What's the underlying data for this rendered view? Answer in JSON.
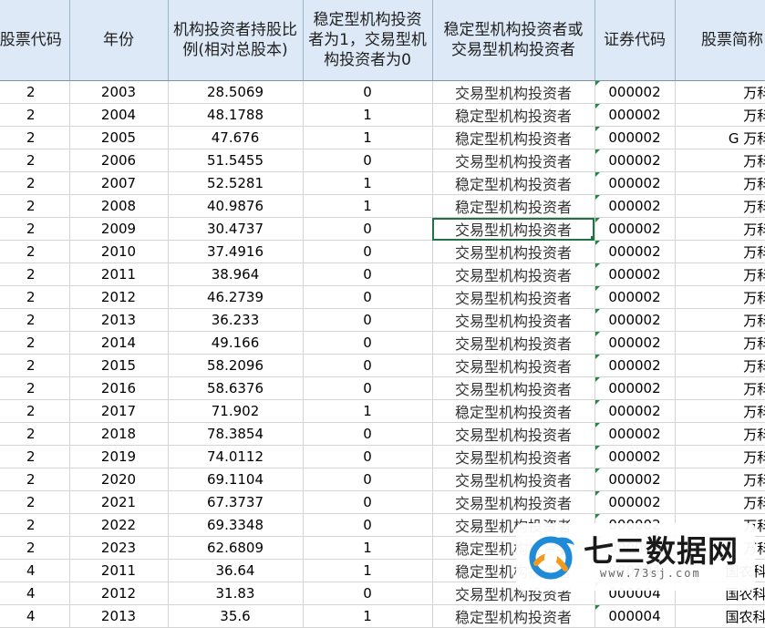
{
  "headers": [
    "股票代码",
    "年份",
    "机构投资者持股比例(相对总股本)",
    "稳定型机构投资者为1，交易型机构投资者为0",
    "稳定型机构投资者或交易型机构投资者",
    "证券代码",
    "股票简称"
  ],
  "rows": [
    [
      "2",
      "2003",
      "28.5069",
      "0",
      "交易型机构投资者",
      "000002",
      "万科A"
    ],
    [
      "2",
      "2004",
      "48.1788",
      "1",
      "稳定型机构投资者",
      "000002",
      "万科A"
    ],
    [
      "2",
      "2005",
      "47.676",
      "1",
      "稳定型机构投资者",
      "000002",
      "G 万科A"
    ],
    [
      "2",
      "2006",
      "51.5455",
      "0",
      "交易型机构投资者",
      "000002",
      "万科A"
    ],
    [
      "2",
      "2007",
      "52.5281",
      "1",
      "稳定型机构投资者",
      "000002",
      "万科A"
    ],
    [
      "2",
      "2008",
      "40.9876",
      "1",
      "稳定型机构投资者",
      "000002",
      "万科A"
    ],
    [
      "2",
      "2009",
      "30.4737",
      "0",
      "交易型机构投资者",
      "000002",
      "万科A"
    ],
    [
      "2",
      "2010",
      "37.4916",
      "0",
      "交易型机构投资者",
      "000002",
      "万科A"
    ],
    [
      "2",
      "2011",
      "38.964",
      "0",
      "交易型机构投资者",
      "000002",
      "万科A"
    ],
    [
      "2",
      "2012",
      "46.2739",
      "0",
      "交易型机构投资者",
      "000002",
      "万科A"
    ],
    [
      "2",
      "2013",
      "36.233",
      "0",
      "交易型机构投资者",
      "000002",
      "万科A"
    ],
    [
      "2",
      "2014",
      "49.166",
      "0",
      "交易型机构投资者",
      "000002",
      "万科A"
    ],
    [
      "2",
      "2015",
      "58.2096",
      "0",
      "交易型机构投资者",
      "000002",
      "万科A"
    ],
    [
      "2",
      "2016",
      "58.6376",
      "0",
      "交易型机构投资者",
      "000002",
      "万科A"
    ],
    [
      "2",
      "2017",
      "71.902",
      "1",
      "稳定型机构投资者",
      "000002",
      "万科A"
    ],
    [
      "2",
      "2018",
      "78.3854",
      "0",
      "交易型机构投资者",
      "000002",
      "万科A"
    ],
    [
      "2",
      "2019",
      "74.0112",
      "0",
      "交易型机构投资者",
      "000002",
      "万科A"
    ],
    [
      "2",
      "2020",
      "69.1104",
      "0",
      "交易型机构投资者",
      "000002",
      "万科A"
    ],
    [
      "2",
      "2021",
      "67.3737",
      "0",
      "交易型机构投资者",
      "000002",
      "万科A"
    ],
    [
      "2",
      "2022",
      "69.3348",
      "0",
      "交易型机构投资者",
      "000002",
      "万科A"
    ],
    [
      "2",
      "2023",
      "62.6809",
      "1",
      "稳定型机构投资者",
      "000002",
      "万科A"
    ],
    [
      "4",
      "2011",
      "36.64",
      "1",
      "稳定型机构投资者",
      "000004",
      "国农科技"
    ],
    [
      "4",
      "2012",
      "31.83",
      "0",
      "交易型机构投资者",
      "000004",
      "国农科技"
    ],
    [
      "4",
      "2013",
      "35.6",
      "1",
      "稳定型机构投资者",
      "000004",
      "国农科技"
    ]
  ],
  "selected_row_index": 6,
  "selected_col_index": 4,
  "watermark": {
    "title": "七三数据网",
    "url": "www.73sj.com"
  }
}
